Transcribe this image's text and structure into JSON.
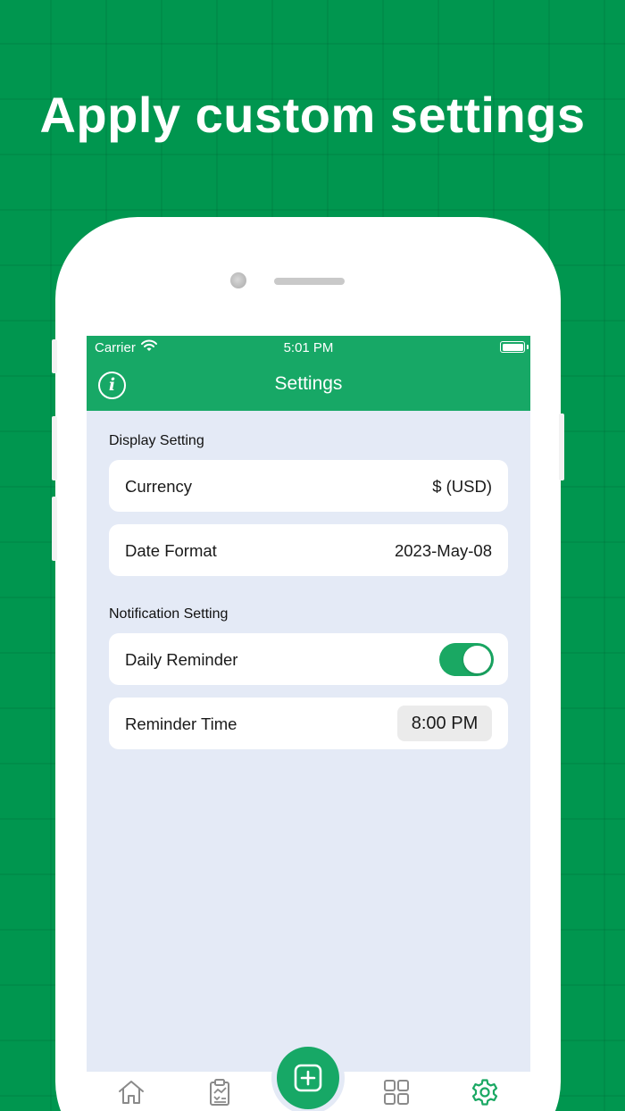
{
  "headline": "Apply custom settings",
  "status_bar": {
    "carrier": "Carrier",
    "time": "5:01 PM"
  },
  "nav": {
    "title": "Settings",
    "info_icon": "info-icon"
  },
  "display_section": {
    "title": "Display Setting",
    "rows": [
      {
        "label": "Currency",
        "value": "$ (USD)"
      },
      {
        "label": "Date Format",
        "value": "2023-May-08"
      }
    ]
  },
  "notification_section": {
    "title": "Notification Setting",
    "daily_reminder": {
      "label": "Daily Reminder",
      "enabled": true
    },
    "reminder_time": {
      "label": "Reminder Time",
      "value": "8:00 PM"
    }
  },
  "tab_bar": {
    "items": [
      "home-icon",
      "report-icon",
      "add-icon",
      "grid-icon",
      "settings-icon"
    ],
    "active": "settings-icon"
  },
  "colors": {
    "background": "#00964f",
    "accent": "#17a866",
    "screen_bg": "#e4eaf6",
    "active_tab": "#1aa863",
    "inactive_tab": "#8a8a8a"
  }
}
